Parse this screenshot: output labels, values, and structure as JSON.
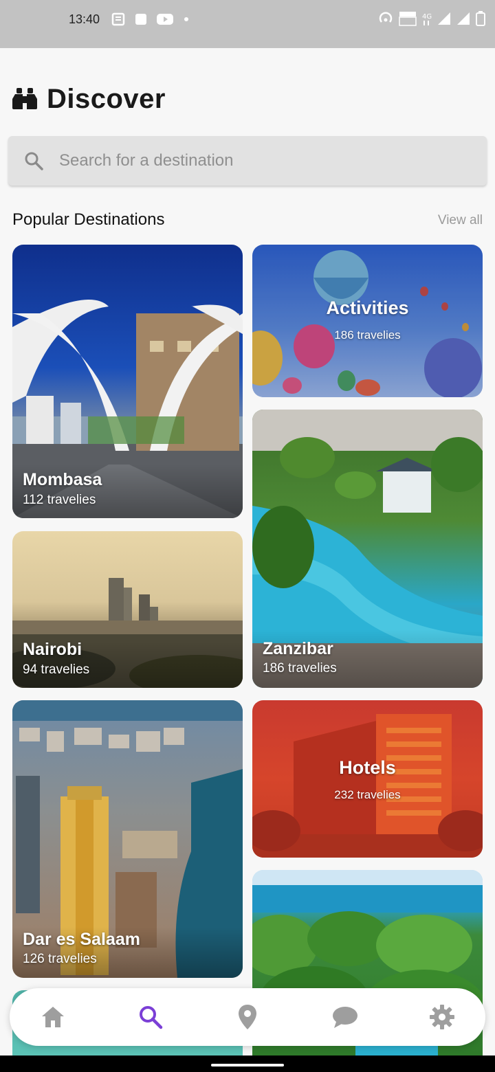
{
  "status_bar": {
    "time": "13:40",
    "left_icons": [
      "news-icon",
      "square-icon",
      "youtube-icon",
      "dot-icon"
    ],
    "right_icons": [
      "hotspot-icon",
      "volte-icon",
      "4g-icon",
      "signal-icon",
      "signal-icon",
      "battery-icon"
    ]
  },
  "header": {
    "title": "Discover",
    "icon": "binoculars-icon"
  },
  "search": {
    "placeholder": "Search for a destination"
  },
  "section": {
    "title": "Popular Destinations",
    "view_all": "View all"
  },
  "cards": [
    {
      "name": "Mombasa",
      "count": "112 travelies"
    },
    {
      "name": "Activities",
      "count": "186 travelies"
    },
    {
      "name": "Zanzibar",
      "count": "186 travelies"
    },
    {
      "name": "Nairobi",
      "count": "94 travelies"
    },
    {
      "name": "Hotels",
      "count": "232 travelies"
    },
    {
      "name": "Dar es Salaam",
      "count": "126 travelies"
    }
  ],
  "nav": {
    "items": [
      "home-icon",
      "search-icon",
      "location-icon",
      "chat-icon",
      "settings-icon"
    ],
    "active": "search-icon",
    "active_color": "#7b3fd6",
    "inactive_color": "#9e9e9e"
  }
}
